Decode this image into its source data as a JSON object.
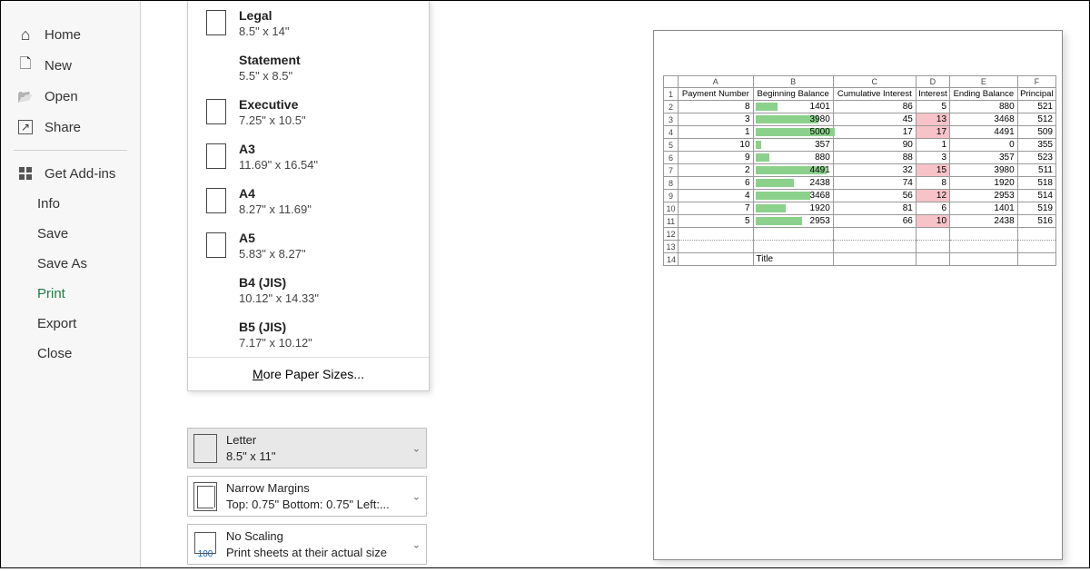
{
  "sidebar": {
    "home": "Home",
    "new_": "New",
    "open": "Open",
    "share": "Share",
    "addins": "Get Add-ins",
    "info": "Info",
    "save": "Save",
    "saveas": "Save As",
    "print": "Print",
    "export": "Export",
    "close": "Close"
  },
  "paper_sizes": [
    {
      "name": "Legal",
      "dim": "8.5\" x 14\"",
      "icon": true
    },
    {
      "name": "Statement",
      "dim": "5.5\" x 8.5\"",
      "icon": false
    },
    {
      "name": "Executive",
      "dim": "7.25\" x 10.5\"",
      "icon": true
    },
    {
      "name": "A3",
      "dim": "11.69\" x 16.54\"",
      "icon": true
    },
    {
      "name": "A4",
      "dim": "8.27\" x 11.69\"",
      "icon": true
    },
    {
      "name": "A5",
      "dim": "5.83\" x 8.27\"",
      "icon": true
    },
    {
      "name": "B4 (JIS)",
      "dim": "10.12\" x 14.33\"",
      "icon": false
    },
    {
      "name": "B5 (JIS)",
      "dim": "7.17\" x 10.12\"",
      "icon": false
    }
  ],
  "more_sizes": "More Paper Sizes...",
  "settings": {
    "paper": {
      "title": "Letter",
      "sub": "8.5\" x 11\""
    },
    "margins": {
      "title": "Narrow Margins",
      "sub": "Top: 0.75\" Bottom: 0.75\" Left:..."
    },
    "scaling": {
      "title": "No Scaling",
      "sub": "Print sheets at their actual size",
      "num": "100"
    }
  },
  "preview": {
    "cols": [
      "A",
      "B",
      "C",
      "D",
      "E",
      "F"
    ],
    "headers": [
      "Payment Number",
      "Beginning Balance",
      "Cumulative Interest",
      "Interest",
      "Ending Balance",
      "Principal"
    ],
    "rows": [
      {
        "r": 2,
        "a": 8,
        "b": 1401,
        "c": 86,
        "d": 5,
        "dpink": false,
        "e": 880,
        "f": 521
      },
      {
        "r": 3,
        "a": 3,
        "b": 3980,
        "c": 45,
        "d": 13,
        "dpink": true,
        "e": 3468,
        "f": 512
      },
      {
        "r": 4,
        "a": 1,
        "b": 5000,
        "c": 17,
        "d": 17,
        "dpink": true,
        "e": 4491,
        "f": 509
      },
      {
        "r": 5,
        "a": 10,
        "b": 357,
        "c": 90,
        "d": 1,
        "dpink": false,
        "e": 0,
        "f": 355
      },
      {
        "r": 6,
        "a": 9,
        "b": 880,
        "c": 88,
        "d": 3,
        "dpink": false,
        "e": 357,
        "f": 523
      },
      {
        "r": 7,
        "a": 2,
        "b": 4491,
        "c": 32,
        "d": 15,
        "dpink": true,
        "e": 3980,
        "f": 511
      },
      {
        "r": 8,
        "a": 6,
        "b": 2438,
        "c": 74,
        "d": 8,
        "dpink": false,
        "e": 1920,
        "f": 518
      },
      {
        "r": 9,
        "a": 4,
        "b": 3468,
        "c": 56,
        "d": 12,
        "dpink": true,
        "e": 2953,
        "f": 514
      },
      {
        "r": 10,
        "a": 7,
        "b": 1920,
        "c": 81,
        "d": 6,
        "dpink": false,
        "e": 1401,
        "f": 519
      },
      {
        "r": 11,
        "a": 5,
        "b": 2953,
        "c": 66,
        "d": 10,
        "dpink": true,
        "e": 2438,
        "f": 516
      }
    ],
    "empty_rows": [
      12,
      13
    ],
    "title_row": {
      "r": 14,
      "label": "Title"
    },
    "b_max": 5000
  }
}
